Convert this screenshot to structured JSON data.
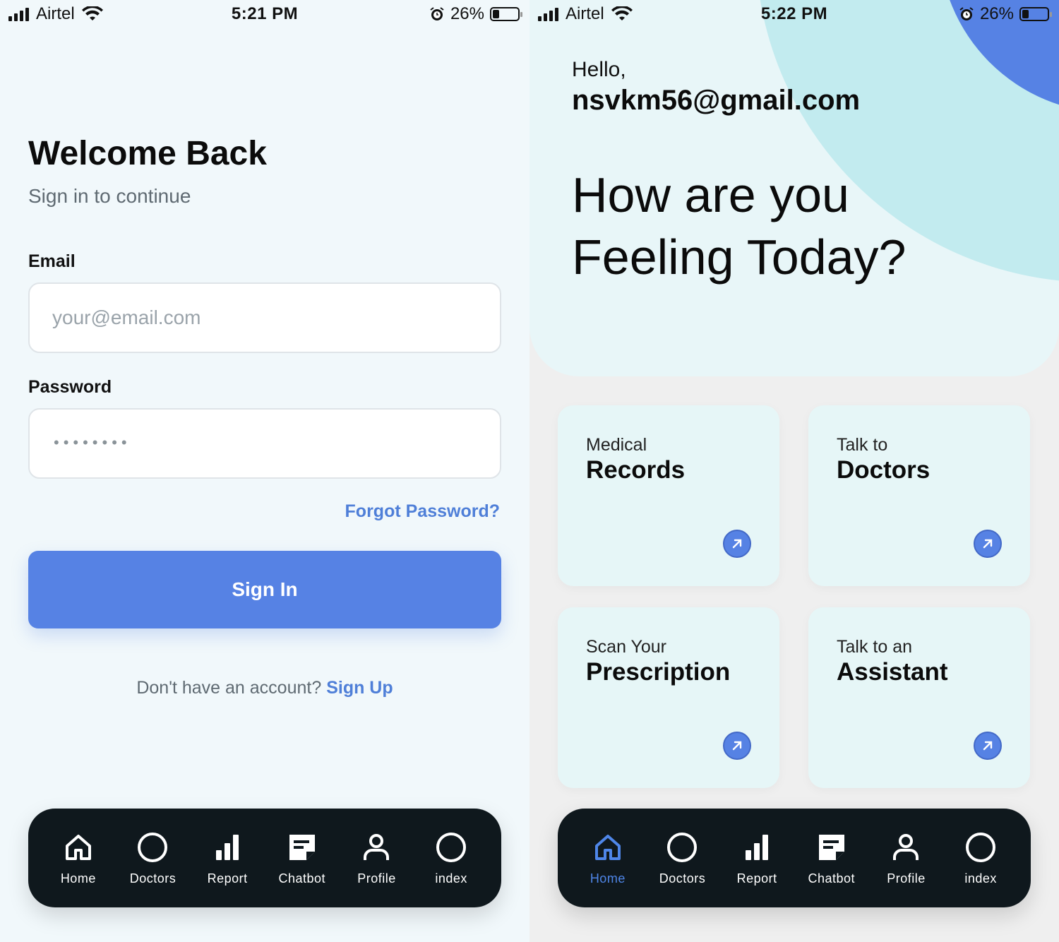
{
  "colors": {
    "accent": "#5682e4",
    "nav_bg": "#0f181d",
    "card_bg": "#e6f6f7",
    "login_bg": "#f1f8fb"
  },
  "left": {
    "status": {
      "carrier": "Airtel",
      "time": "5:21 PM",
      "battery": "26%",
      "battery_level": 0.26
    },
    "title": "Welcome Back",
    "subtitle": "Sign in to continue",
    "email_label": "Email",
    "email_placeholder": "your@email.com",
    "password_label": "Password",
    "password_mask": "••••••••",
    "forgot": "Forgot Password?",
    "signin": "Sign In",
    "no_account": "Don't have an account?",
    "signup": "Sign Up",
    "nav": {
      "home": "Home",
      "doctors": "Doctors",
      "report": "Report",
      "chatbot": "Chatbot",
      "profile": "Profile",
      "index": "index"
    }
  },
  "right": {
    "status": {
      "carrier": "Airtel",
      "time": "5:22 PM",
      "battery": "26%",
      "battery_level": 0.26
    },
    "hello": "Hello,",
    "email": "nsvkm56@gmail.com",
    "heading_line1": "How are you",
    "heading_line2": "Feeling Today?",
    "cards": [
      {
        "top": "Medical",
        "main": "Records"
      },
      {
        "top": "Talk to",
        "main": "Doctors"
      },
      {
        "top": "Scan Your",
        "main": "Prescription"
      },
      {
        "top": "Talk to an",
        "main": "Assistant"
      }
    ],
    "nav": {
      "active": "Home",
      "home": "Home",
      "doctors": "Doctors",
      "report": "Report",
      "chatbot": "Chatbot",
      "profile": "Profile",
      "index": "index"
    }
  }
}
